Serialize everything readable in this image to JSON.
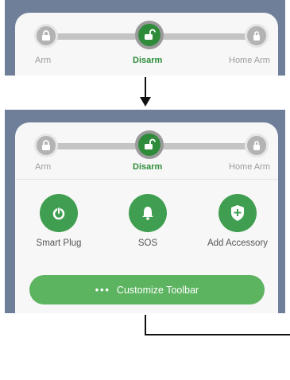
{
  "modes": [
    {
      "label": "Arm",
      "icon": "lock-icon"
    },
    {
      "label": "Disarm",
      "icon": "unlock-icon"
    },
    {
      "label": "Home Arm",
      "icon": "home-lock-icon"
    }
  ],
  "active_mode": "Disarm",
  "actions": [
    {
      "label": "Smart Plug",
      "icon": "power-icon"
    },
    {
      "label": "SOS",
      "icon": "bell-icon"
    },
    {
      "label": "Add Accessory",
      "icon": "shield-plus-icon"
    }
  ],
  "toolbar": {
    "label": "Customize Toolbar",
    "icon": "more-dots-icon"
  },
  "colors": {
    "accent": "#2e8b3a",
    "button_green": "#5cb360",
    "background_panel": "#6f7f99"
  }
}
